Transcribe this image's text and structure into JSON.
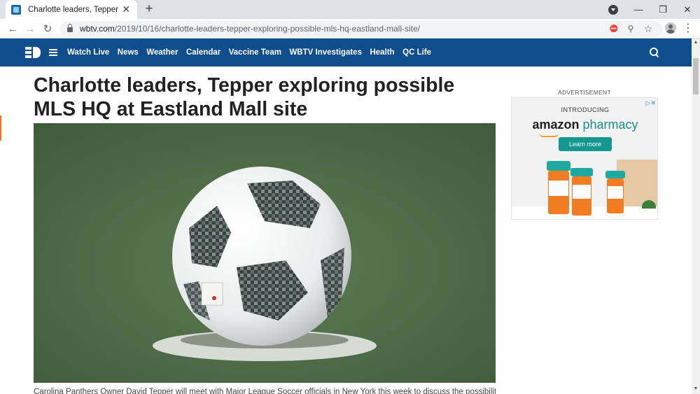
{
  "browser": {
    "tab_title": "Charlotte leaders, Tepper explorin",
    "tab_close": "✕",
    "new_tab": "+",
    "url_domain": "wbtv.com",
    "url_path": "/2019/10/16/charlotte-leaders-tepper-exploring-possible-mls-hq-eastland-mall-site/",
    "back": "←",
    "forward": "→",
    "reload": "↻",
    "minimize": "—",
    "restore": "❐",
    "close": "✕",
    "menu": "⋮",
    "zoom": "⚲",
    "bookmark": "☆",
    "blocked": "⛔"
  },
  "site": {
    "nav_links": [
      "Watch Live",
      "News",
      "Weather",
      "Calendar",
      "Vaccine Team",
      "WBTV Investigates",
      "Health",
      "QC Life"
    ],
    "accent_color": "#0f4d8c"
  },
  "article": {
    "headline": "Charlotte leaders, Tepper exploring possible MLS HQ at Eastland Mall site",
    "caption": "Carolina Panthers Owner David Tepper will meet with Major League Soccer officials in New York this week to discuss the possibility of bringing an"
  },
  "ad": {
    "label": "ADVERTISEMENT",
    "choice": "▷✕",
    "intro": "INTRODUCING",
    "brand": "amazon",
    "product": "pharmacy",
    "cta": "Learn more"
  }
}
